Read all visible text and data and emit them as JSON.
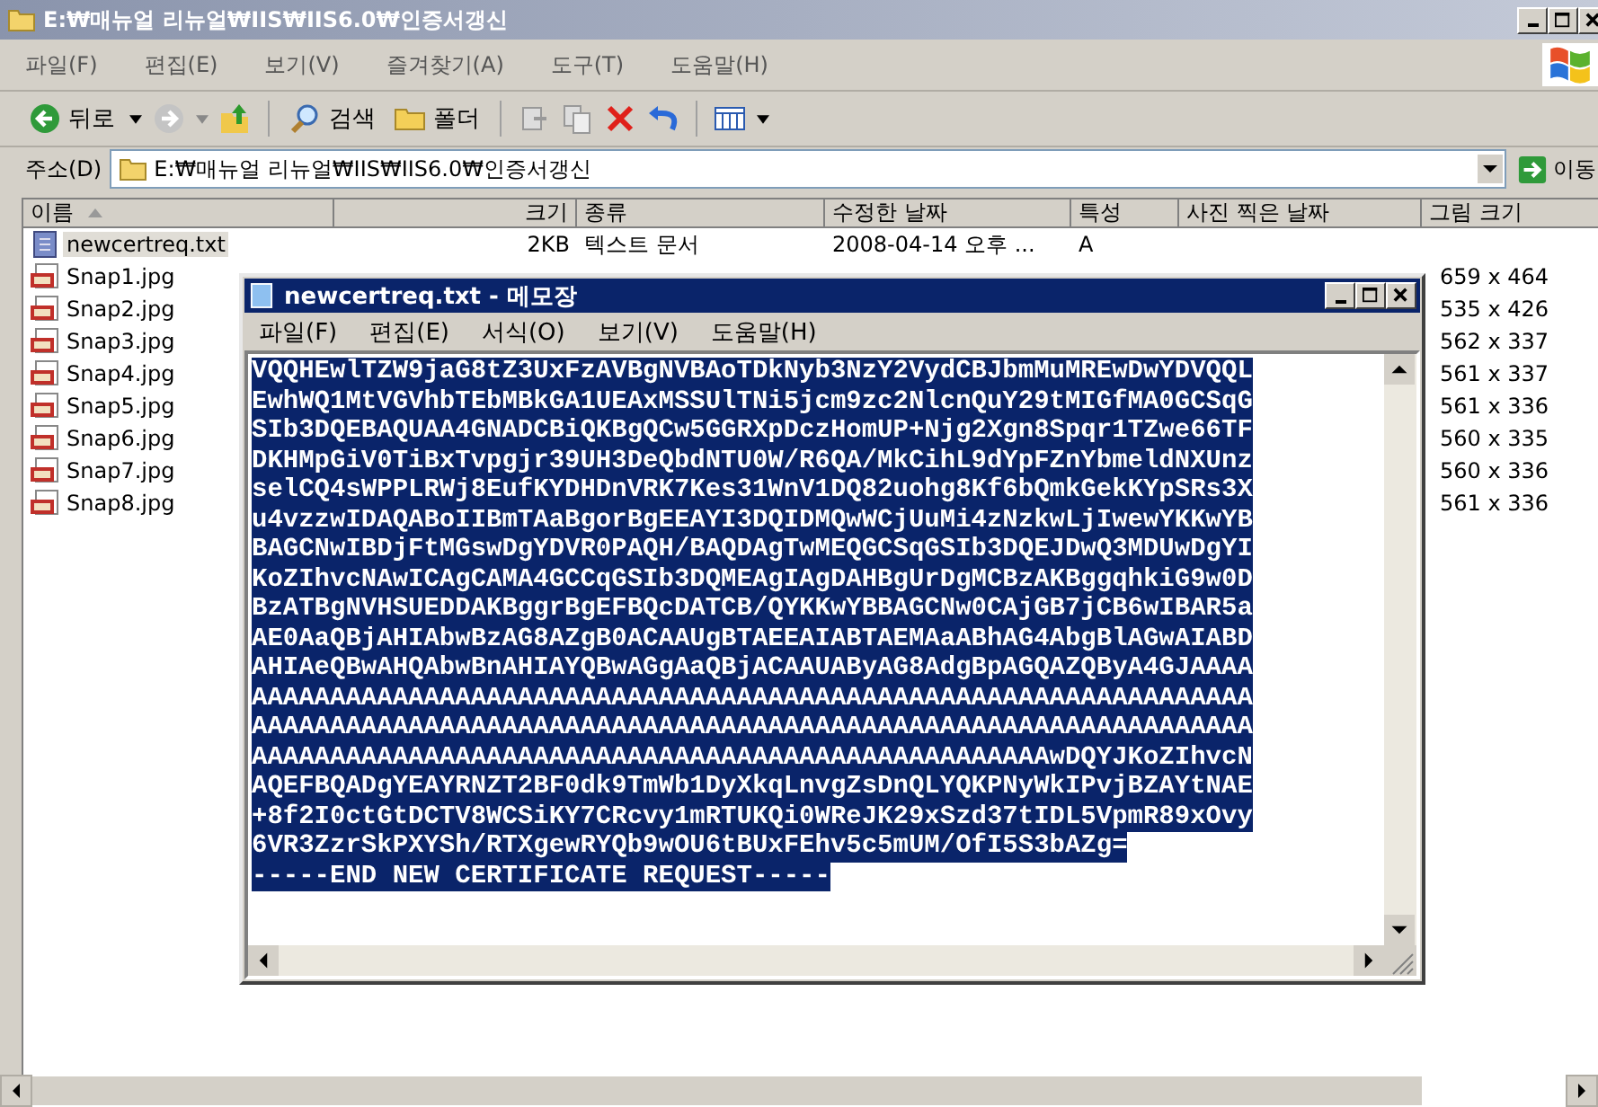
{
  "explorer": {
    "title": "E:₩매뉴얼 리뉴얼₩IIS₩IIS6.0₩인증서갱신",
    "menu": [
      "파일(F)",
      "편집(E)",
      "보기(V)",
      "즐겨찾기(A)",
      "도구(T)",
      "도움말(H)"
    ],
    "toolbar": {
      "back": "뒤로",
      "search": "검색",
      "folders": "폴더"
    },
    "address": {
      "label": "주소(D)",
      "value": "E:₩매뉴얼 리뉴얼₩IIS₩IIS6.0₩인증서갱신",
      "go": "이동"
    },
    "columns": [
      "이름",
      "크기",
      "종류",
      "수정한 날짜",
      "특성",
      "사진 찍은 날짜",
      "그림 크기"
    ],
    "files": [
      {
        "kind": "text",
        "name": "newcertreq.txt",
        "size": "2KB",
        "type": "텍스트 문서",
        "modified": "2008-04-14 오후 ...",
        "attr": "A",
        "selected": true
      },
      {
        "kind": "jpg",
        "name": "Snap1.jpg",
        "dimensions": "659 x 464",
        "selected": false
      },
      {
        "kind": "jpg",
        "name": "Snap2.jpg",
        "dimensions": "535 x 426",
        "selected": false
      },
      {
        "kind": "jpg",
        "name": "Snap3.jpg",
        "dimensions": "562 x 337",
        "selected": false
      },
      {
        "kind": "jpg",
        "name": "Snap4.jpg",
        "dimensions": "561 x 337",
        "selected": false
      },
      {
        "kind": "jpg",
        "name": "Snap5.jpg",
        "dimensions": "561 x 336",
        "selected": false
      },
      {
        "kind": "jpg",
        "name": "Snap6.jpg",
        "dimensions": "560 x 335",
        "selected": false
      },
      {
        "kind": "jpg",
        "name": "Snap7.jpg",
        "dimensions": "560 x 336",
        "selected": false
      },
      {
        "kind": "jpg",
        "name": "Snap8.jpg",
        "dimensions": "561 x 336",
        "selected": false
      }
    ]
  },
  "notepad": {
    "title": "newcertreq.txt - 메모장",
    "menu": [
      "파일(F)",
      "편집(E)",
      "서식(O)",
      "보기(V)",
      "도움말(H)"
    ],
    "selected": true,
    "lines": [
      "VQQHEwlTZW9jaG8tZ3UxFzAVBgNVBAoTDkNyb3NzY2VydCBJbmMuMREwDwYDVQQL",
      "EwhWQ1MtVGVhbTEbMBkGA1UEAxMSSUlTNi5jcm9zc2NlcnQuY29tMIGfMA0GCSqG",
      "SIb3DQEBAQUAA4GNADCBiQKBgQCw5GGRXpDczHomUP+Njg2Xgn8Spqr1TZwe66TF",
      "DKHMpGiV0TiBxTvpgjr39UH3DeQbdNTU0W/R6QA/MkCihL9dYpFZnYbmeldNXUnz",
      "selCQ4sWPPLRWj8EufKYDHDnVRK7Kes31WnV1DQ82uohg8Kf6bQmkGekKYpSRs3X",
      "u4vzzwIDAQABoIIBmTAaBgorBgEEAYI3DQIDMQwWCjUuMi4zNzkwLjIwewYKKwYB",
      "BAGCNwIBDjFtMGswDgYDVR0PAQH/BAQDAgTwMEQGCSqGSIb3DQEJDwQ3MDUwDgYI",
      "KoZIhvcNAwICAgCAMA4GCCqGSIb3DQMEAgIAgDAHBgUrDgMCBzAKBggqhkiG9w0D",
      "BzATBgNVHSUEDDAKBggrBgEFBQcDATCB/QYKKwYBBAGCNw0CAjGB7jCB6wIBAR5a",
      "AE0AaQBjAHIAbwBzAG8AZgB0ACAAUgBTAEEAIABTAEMAaABhAG4AbgBlAGwAIABD",
      "AHIAeQBwAHQAbwBnAHIAYQBwAGgAaQBjACAAUAByAG8AdgBpAGQAZQByA4GJAAAA",
      "AAAAAAAAAAAAAAAAAAAAAAAAAAAAAAAAAAAAAAAAAAAAAAAAAAAAAAAAAAAAAAAA",
      "AAAAAAAAAAAAAAAAAAAAAAAAAAAAAAAAAAAAAAAAAAAAAAAAAAAAAAAAAAAAAAAA",
      "AAAAAAAAAAAAAAAAAAAAAAAAAAAAAAAAAAAAAAAAAAAAAAAAAAAwDQYJKoZIhvcN",
      "AQEFBQADgYEAYRNZT2BF0dk9TmWb1DyXkqLnvgZsDnQLYQKPNyWkIPvjBZAYtNAE",
      "+8f2I0ctGtDCTV8WCSiKY7CRcvy1mRTUKQi0WReJK29xSzd37tIDL5VpmR89xOvy",
      "6VR3ZzrSkPXYSh/RTXgewRYQb9wOU6tBUxFEhv5c5mUM/OfI5S3bAZg=",
      "-----END NEW CERTIFICATE REQUEST-----"
    ]
  }
}
